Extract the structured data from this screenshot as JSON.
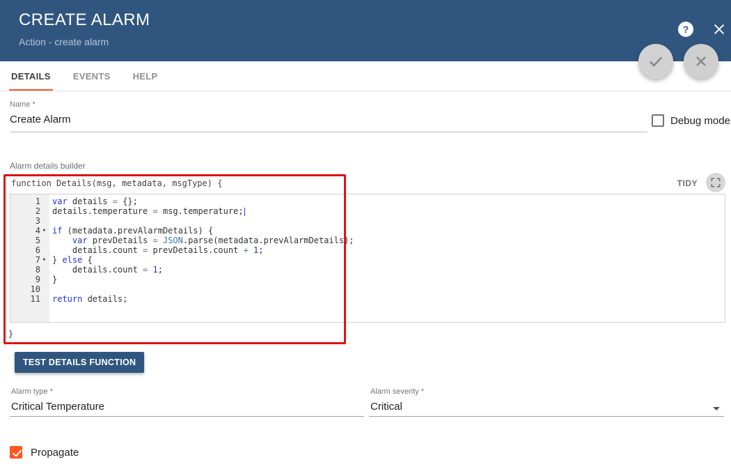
{
  "colors": {
    "header_bg": "#305680",
    "accent": "#ff5722",
    "annotation": "#e01212",
    "primary_button": "#305680"
  },
  "header": {
    "title": "CREATE ALARM",
    "subtitle": "Action - create alarm",
    "help_icon": "?"
  },
  "tabs": [
    {
      "label": "DETAILS",
      "active": true
    },
    {
      "label": "EVENTS",
      "active": false
    },
    {
      "label": "HELP",
      "active": false
    }
  ],
  "form": {
    "name": {
      "label": "Name *",
      "value": "Create Alarm"
    },
    "debug_mode": {
      "label": "Debug mode",
      "checked": false
    },
    "builder_label": "Alarm details builder",
    "test_button_label": "TEST DETAILS FUNCTION",
    "alarm_type": {
      "label": "Alarm type *",
      "value": "Critical Temperature"
    },
    "alarm_severity": {
      "label": "Alarm severity *",
      "value": "Critical"
    },
    "propagate": {
      "label": "Propagate",
      "checked": true
    }
  },
  "editor": {
    "signature": "function Details(msg, metadata, msgType) {",
    "closing_brace": "}",
    "tidy_label": "TIDY",
    "lines": [
      {
        "num": 1,
        "tokens": [
          {
            "t": "var",
            "c": "kw"
          },
          {
            "t": " details ",
            "c": ""
          },
          {
            "t": "=",
            "c": "op"
          },
          {
            "t": " {};",
            "c": ""
          }
        ]
      },
      {
        "num": 2,
        "cursor": true,
        "tokens": [
          {
            "t": "details.temperature ",
            "c": ""
          },
          {
            "t": "=",
            "c": "op"
          },
          {
            "t": " msg.temperature;",
            "c": ""
          }
        ]
      },
      {
        "num": 3,
        "tokens": []
      },
      {
        "num": 4,
        "fold": true,
        "tokens": [
          {
            "t": "if",
            "c": "kw"
          },
          {
            "t": " (metadata.prevAlarmDetails) {",
            "c": ""
          }
        ]
      },
      {
        "num": 5,
        "tokens": [
          {
            "t": "    ",
            "c": ""
          },
          {
            "t": "var",
            "c": "kw"
          },
          {
            "t": " prevDetails ",
            "c": ""
          },
          {
            "t": "=",
            "c": "op"
          },
          {
            "t": " ",
            "c": ""
          },
          {
            "t": "JSON",
            "c": "sup"
          },
          {
            "t": ".parse(metadata.prevAlarmDetails);",
            "c": ""
          }
        ]
      },
      {
        "num": 6,
        "tokens": [
          {
            "t": "    details.count ",
            "c": ""
          },
          {
            "t": "=",
            "c": "op"
          },
          {
            "t": " prevDetails.count ",
            "c": ""
          },
          {
            "t": "+",
            "c": "op"
          },
          {
            "t": " ",
            "c": ""
          },
          {
            "t": "1",
            "c": "num"
          },
          {
            "t": ";",
            "c": ""
          }
        ]
      },
      {
        "num": 7,
        "fold": true,
        "tokens": [
          {
            "t": "} ",
            "c": ""
          },
          {
            "t": "else",
            "c": "kw"
          },
          {
            "t": " {",
            "c": ""
          }
        ]
      },
      {
        "num": 8,
        "tokens": [
          {
            "t": "    details.count ",
            "c": ""
          },
          {
            "t": "=",
            "c": "op"
          },
          {
            "t": " ",
            "c": ""
          },
          {
            "t": "1",
            "c": "num"
          },
          {
            "t": ";",
            "c": ""
          }
        ]
      },
      {
        "num": 9,
        "tokens": [
          {
            "t": "}",
            "c": ""
          }
        ]
      },
      {
        "num": 10,
        "tokens": []
      },
      {
        "num": 11,
        "tokens": [
          {
            "t": "return",
            "c": "kw"
          },
          {
            "t": " details;",
            "c": ""
          }
        ]
      }
    ]
  }
}
